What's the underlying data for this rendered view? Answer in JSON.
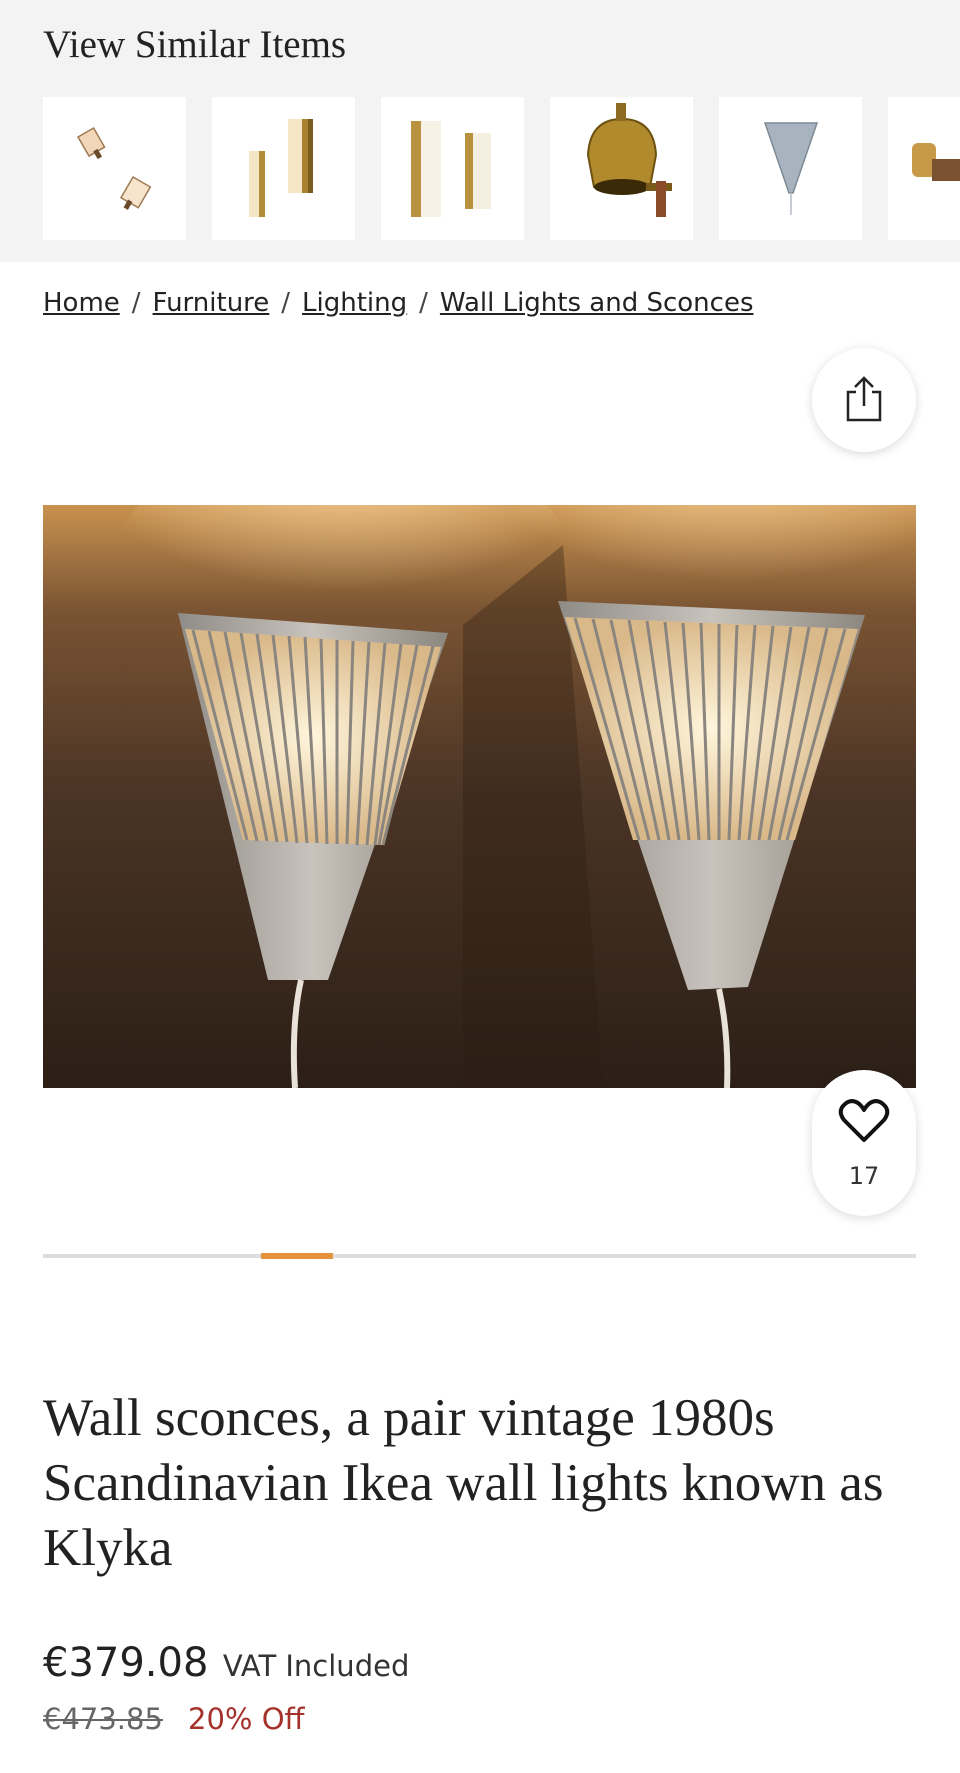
{
  "similar": {
    "title": "View Similar Items",
    "items": [
      {
        "icon": "two-small-sconces-thumbnail"
      },
      {
        "icon": "brass-panel-sconces-thumbnail"
      },
      {
        "icon": "white-panel-sconces-thumbnail"
      },
      {
        "icon": "brass-dome-sconce-thumbnail"
      },
      {
        "icon": "grey-cone-sconce-thumbnail"
      },
      {
        "icon": "amber-glass-sconce-thumbnail"
      }
    ]
  },
  "breadcrumb": {
    "items": [
      "Home",
      "Furniture",
      "Lighting",
      "Wall Lights and Sconces"
    ],
    "separator": "/"
  },
  "share": {
    "icon": "share-icon"
  },
  "hero_image": {
    "subject": "pair of cone wall sconces, lit, on dark wall"
  },
  "favorite": {
    "icon": "heart-icon",
    "count": "17"
  },
  "gallery": {
    "current_index_fraction": 0.25,
    "accent": "#e8913d"
  },
  "product": {
    "title": "Wall sconces, a pair vintage 1980s Scandinavian Ikea wall lights known as Klyka",
    "price": "€379.08",
    "vat_label": "VAT Included",
    "old_price": "€473.85",
    "discount": "20% Off",
    "discount_color": "#a4322b"
  }
}
